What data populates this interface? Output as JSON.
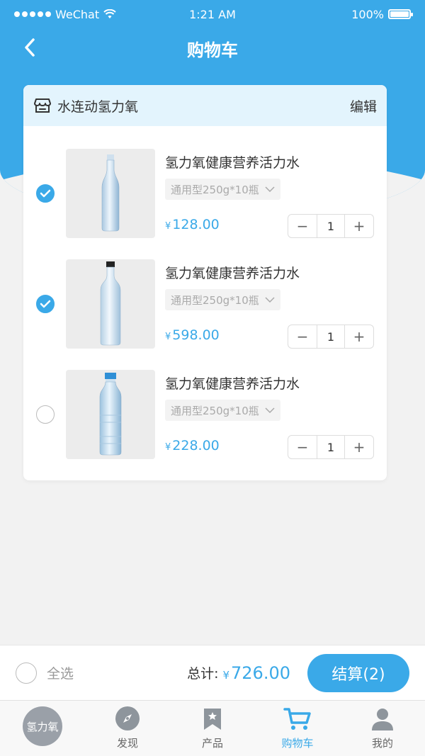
{
  "status_bar": {
    "carrier": "WeChat",
    "time": "1:21 AM",
    "battery": "100%"
  },
  "nav": {
    "title": "购物车"
  },
  "shop": {
    "name": "水连动氢力氧",
    "edit_label": "编辑"
  },
  "items": [
    {
      "name": "氢力氧健康营养活力水",
      "spec": "通用型250g*10瓶",
      "currency": "¥",
      "price": "128.00",
      "qty": "1",
      "checked": true
    },
    {
      "name": "氢力氧健康营养活力水",
      "spec": "通用型250g*10瓶",
      "currency": "¥",
      "price": "598.00",
      "qty": "1",
      "checked": true
    },
    {
      "name": "氢力氧健康营养活力水",
      "spec": "通用型250g*10瓶",
      "currency": "¥",
      "price": "228.00",
      "qty": "1",
      "checked": false
    }
  ],
  "footer": {
    "select_all": "全选",
    "total_label": "总计:",
    "currency": "¥",
    "total": "726.00",
    "checkout": "结算(2)"
  },
  "tabs": [
    {
      "label": "氢力氧",
      "icon": "brand-logo"
    },
    {
      "label": "发现",
      "icon": "compass-icon"
    },
    {
      "label": "产品",
      "icon": "bookmark-icon"
    },
    {
      "label": "购物车",
      "icon": "cart-icon"
    },
    {
      "label": "我的",
      "icon": "user-icon"
    }
  ],
  "colors": {
    "accent": "#3aa9e8",
    "background": "#f2f2f2"
  }
}
